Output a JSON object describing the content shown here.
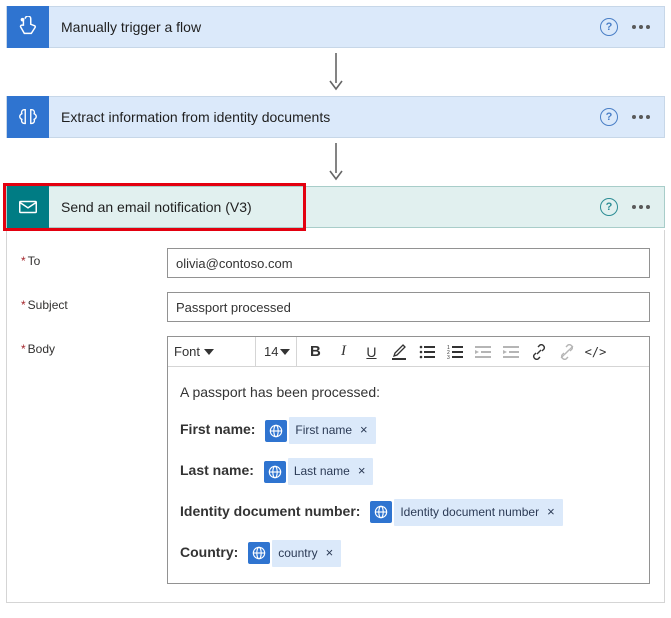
{
  "steps": {
    "s1": {
      "title": "Manually trigger a flow"
    },
    "s2": {
      "title": "Extract information from identity documents"
    },
    "s3": {
      "title": "Send an email notification (V3)"
    }
  },
  "form": {
    "to_label": "To",
    "to_value": "olivia@contoso.com",
    "subject_label": "Subject",
    "subject_value": "Passport processed",
    "body_label": "Body"
  },
  "toolbar": {
    "font_label": "Font",
    "size_label": "14"
  },
  "body": {
    "intro": "A passport has been processed:",
    "rows": {
      "first_name_label": "First name:",
      "first_name_token": "First name",
      "last_name_label": "Last name:",
      "last_name_token": "Last name",
      "doc_num_label": "Identity document number:",
      "doc_num_token": "Identity document number",
      "country_label": "Country:",
      "country_token": "country"
    }
  }
}
